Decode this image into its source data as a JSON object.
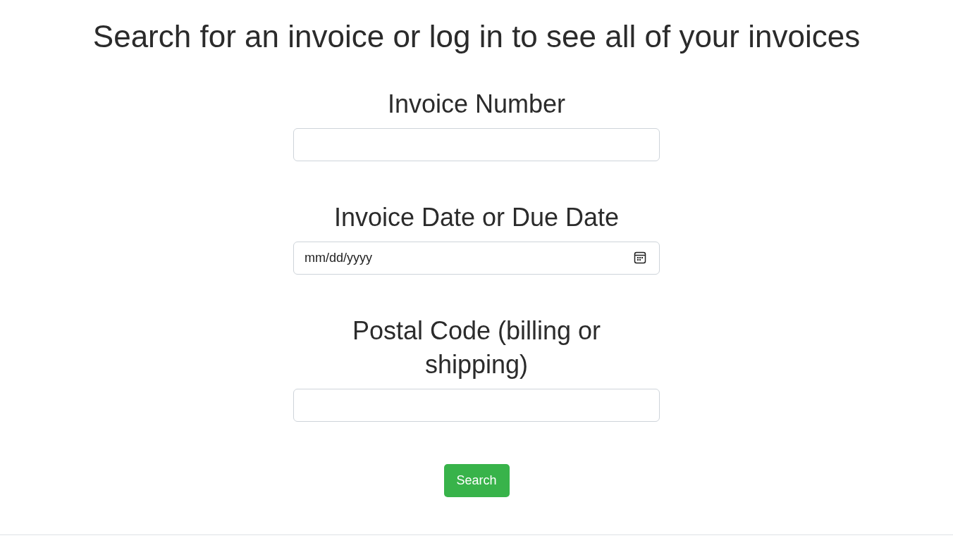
{
  "heading": "Search for an invoice or log in to see all of your invoices",
  "fields": [
    {
      "kind": "text",
      "label": "Invoice Number"
    },
    {
      "kind": "date",
      "label": "Invoice Date or Due Date",
      "placeholder": "mm/dd/yyyy"
    },
    {
      "kind": "text",
      "label": "Postal Code (billing or shipping)"
    }
  ],
  "button": "Search"
}
